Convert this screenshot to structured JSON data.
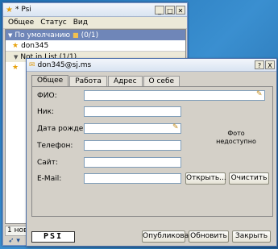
{
  "colors": {
    "desktop": "#2c7fb8",
    "title_bar": "#d9e4f2",
    "group_row": "#6f86b8",
    "accent": "#f2a70c"
  },
  "psi_window": {
    "title": "* Psi",
    "menu": [
      "Общее",
      "Статус",
      "Вид"
    ],
    "roster": {
      "group": "По умолчанию",
      "group_count": "(0/1)",
      "contact": "don345",
      "not_in_list": "Not in List (1/1)"
    },
    "status_fragment": "1 нове"
  },
  "dialog": {
    "title": "don345@sj.ms",
    "help_label": "?",
    "close_label": "X",
    "tabs": [
      "Общее",
      "Работа",
      "Адрес",
      "О себе"
    ],
    "labels": {
      "fio": "ФИО:",
      "nick": "Ник:",
      "birthdate": "Дата рождения:",
      "phone": "Телефон:",
      "site": "Сайт:",
      "email": "E-Mail:"
    },
    "values": {
      "fio": "",
      "nick": "",
      "birthdate": "",
      "phone": "",
      "site": "",
      "email": ""
    },
    "photo_text_line1": "Фото",
    "photo_text_line2": "недоступно",
    "open_label": "Открыть...",
    "clear_label": "Очистить",
    "logo_text": "PSI",
    "publish_label": "Опубликовать",
    "refresh_label": "Обновить",
    "close_button_label": "Закрыть"
  }
}
